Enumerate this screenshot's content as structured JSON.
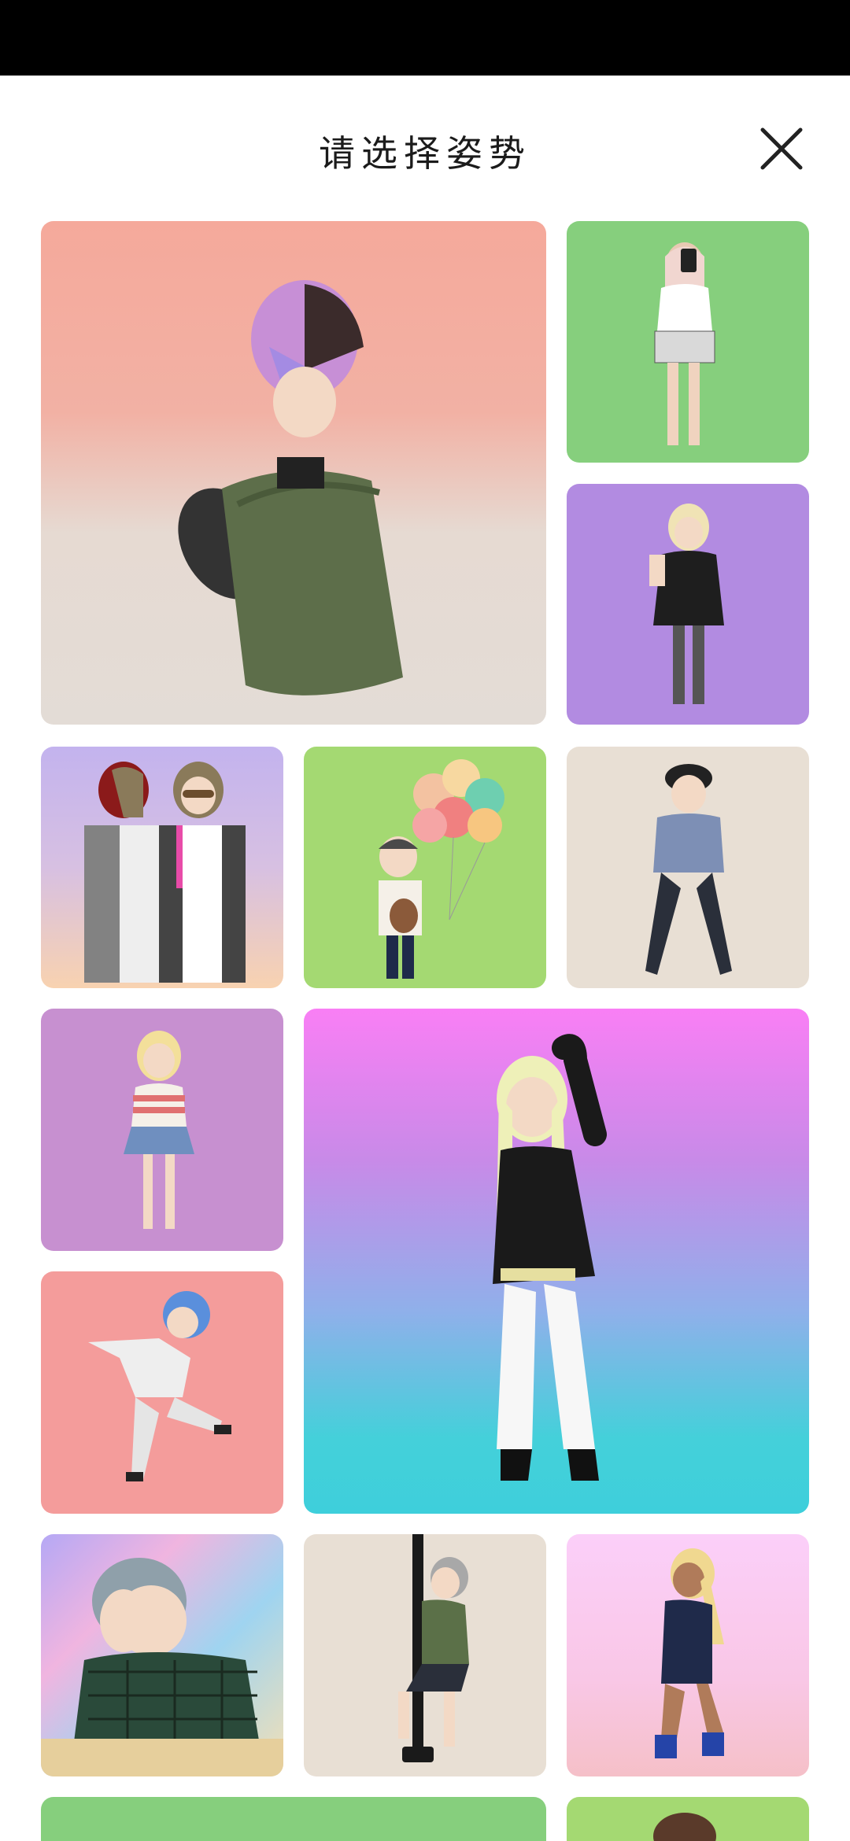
{
  "header": {
    "title": "请选择姿势",
    "close_icon": "close-icon"
  },
  "poses": [
    {
      "id": "pose-1",
      "background": "#f5a99b",
      "figure": "avatar-sitting-back-icon"
    },
    {
      "id": "pose-2",
      "background": "#86cf7d",
      "figure": "avatar-selfie-icon"
    },
    {
      "id": "pose-3",
      "background": "#b28be1",
      "figure": "avatar-phone-icon"
    },
    {
      "id": "pose-4",
      "background": "#c3b3ee",
      "figure": "avatar-pair-icon"
    },
    {
      "id": "pose-5",
      "background": "#a4d972",
      "figure": "avatar-balloons-icon"
    },
    {
      "id": "pose-6",
      "background": "#e8dfd4",
      "figure": "avatar-cap-icon"
    },
    {
      "id": "pose-7",
      "background": "#c790d0",
      "figure": "avatar-girl-icon"
    },
    {
      "id": "pose-8",
      "background": "#f97ff5",
      "figure": "avatar-dance-icon"
    },
    {
      "id": "pose-9",
      "background": "#f49c9b",
      "figure": "avatar-jump-icon"
    },
    {
      "id": "pose-10",
      "background": "#b5a8f5",
      "figure": "avatar-headache-icon"
    },
    {
      "id": "pose-11",
      "background": "#e8dfd4",
      "figure": "avatar-pole-icon"
    },
    {
      "id": "pose-12",
      "background": "#fbcff9",
      "figure": "avatar-pose-icon"
    },
    {
      "id": "pose-13",
      "background": "#86cf7d",
      "figure": "avatar-partial-icon"
    },
    {
      "id": "pose-14",
      "background": "#a4d972",
      "figure": "avatar-partial-icon"
    }
  ]
}
